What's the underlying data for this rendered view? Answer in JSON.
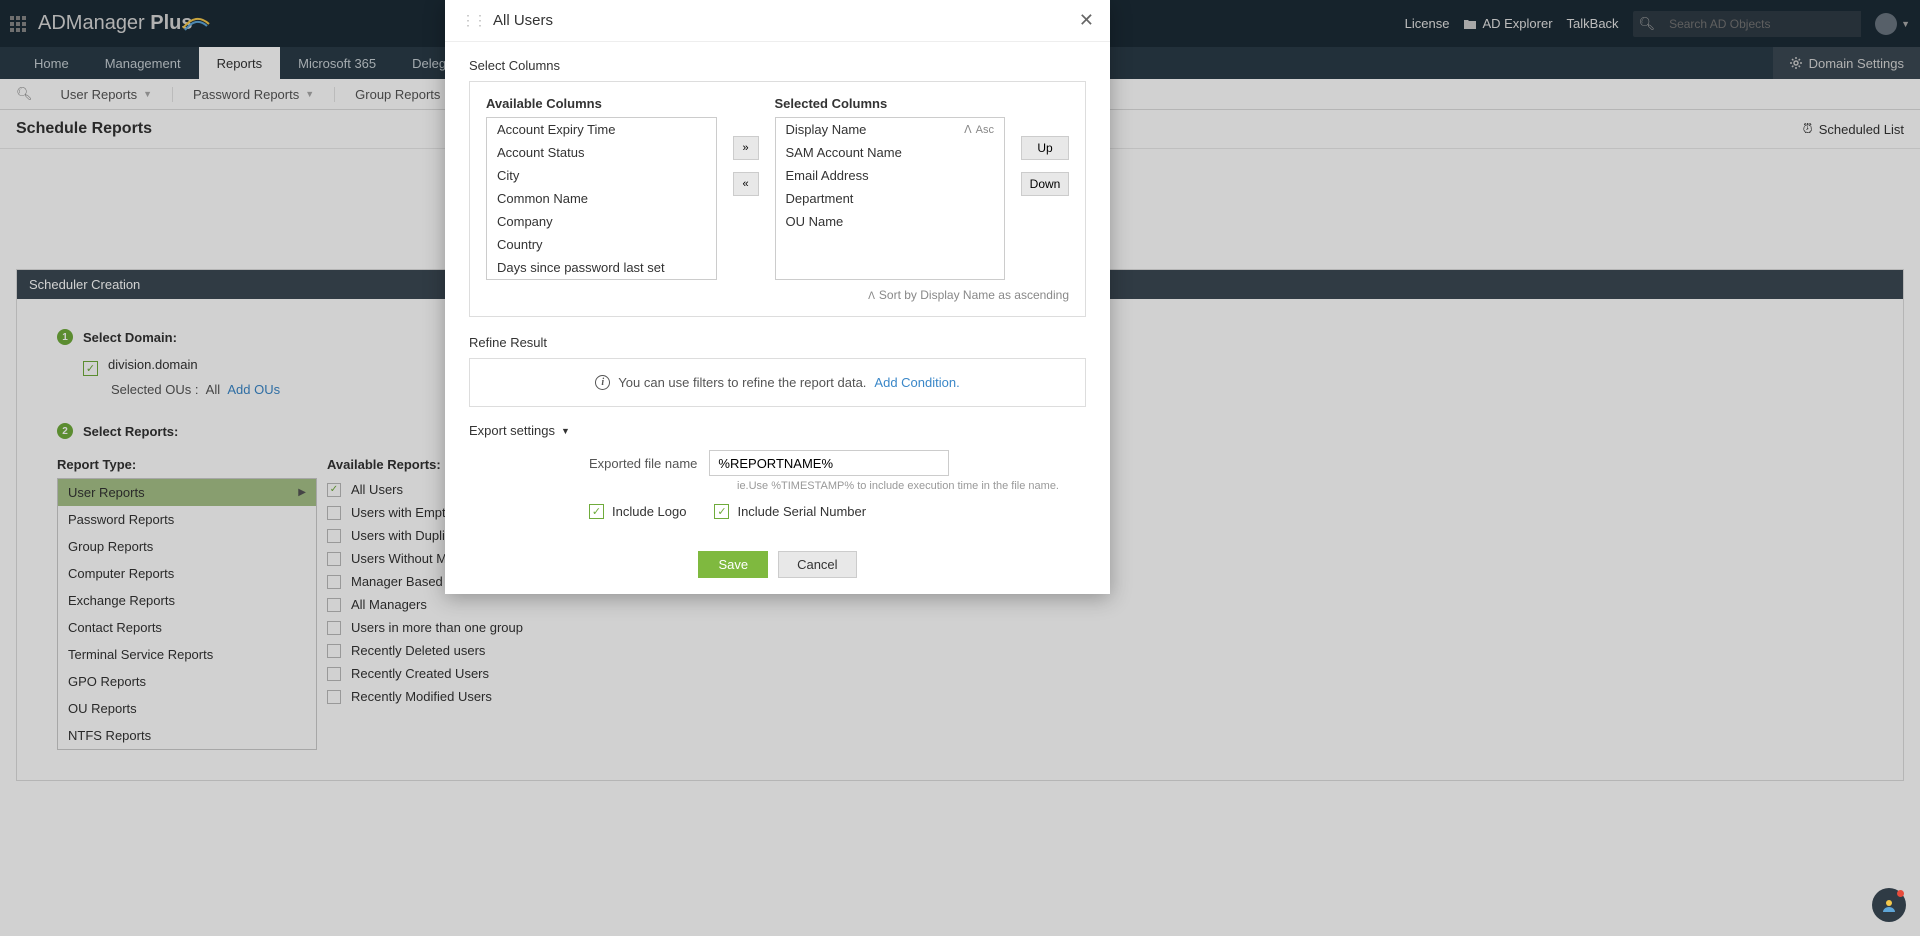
{
  "brand": {
    "text1": "ADManager ",
    "text2": "Plus"
  },
  "top_links": {
    "license": "License",
    "explorer": "AD Explorer",
    "talkback": "TalkBack"
  },
  "search_placeholder": "Search AD Objects",
  "tabs": [
    "Home",
    "Management",
    "Reports",
    "Microsoft 365",
    "Delegation"
  ],
  "active_tab_index": 2,
  "domain_settings_label": "Domain Settings",
  "subnav": [
    "User Reports",
    "Password Reports",
    "Group Reports"
  ],
  "page_title": "Schedule Reports",
  "scheduled_list": "Scheduled List",
  "panel_title": "Scheduler Creation",
  "step1": {
    "label": "Select Domain:",
    "domain": "division.domain",
    "ous_label": "Selected OUs :",
    "ous_value": "All",
    "add_ous": "Add OUs"
  },
  "step2": {
    "label": "Select Reports:",
    "col1": "Report Type:",
    "col2": "Available Reports:"
  },
  "report_types": [
    "User Reports",
    "Password Reports",
    "Group Reports",
    "Computer Reports",
    "Exchange Reports",
    "Contact Reports",
    "Terminal Service Reports",
    "GPO Reports",
    "OU Reports",
    "NTFS Reports"
  ],
  "available_reports": [
    {
      "label": "All Users",
      "checked": true
    },
    {
      "label": "Users with Empty Attributes",
      "checked": false
    },
    {
      "label": "Users with Duplicate Attributes",
      "checked": false
    },
    {
      "label": "Users Without Managers",
      "checked": false
    },
    {
      "label": "Manager Based Users",
      "checked": false
    },
    {
      "label": "All Managers",
      "checked": false
    },
    {
      "label": "Users in more than one group",
      "checked": false
    },
    {
      "label": "Recently Deleted users",
      "checked": false
    },
    {
      "label": "Recently Created Users",
      "checked": false
    },
    {
      "label": "Recently Modified Users",
      "checked": false
    }
  ],
  "modal": {
    "title": "All Users",
    "select_columns": "Select Columns",
    "available": "Available Columns",
    "selected": "Selected Columns",
    "available_list": [
      "Account Expiry Time",
      "Account Status",
      "City",
      "Common Name",
      "Company",
      "Country",
      "Days since password last set"
    ],
    "selected_list": [
      "Display Name",
      "SAM Account Name",
      "Email Address",
      "Department",
      "OU Name"
    ],
    "sort_dir": "Asc",
    "up": "Up",
    "down": "Down",
    "sort_summary": "Sort by Display Name as ascending",
    "refine": "Refine Result",
    "refine_text": "You can use filters to refine the report data.",
    "add_condition": "Add Condition.",
    "export": "Export settings",
    "file_label": "Exported file name",
    "file_value": "%REPORTNAME%",
    "hint": "ie.Use %TIMESTAMP% to include execution time in the file name.",
    "include_logo": "Include Logo",
    "include_serial": "Include Serial Number",
    "save": "Save",
    "cancel": "Cancel"
  }
}
